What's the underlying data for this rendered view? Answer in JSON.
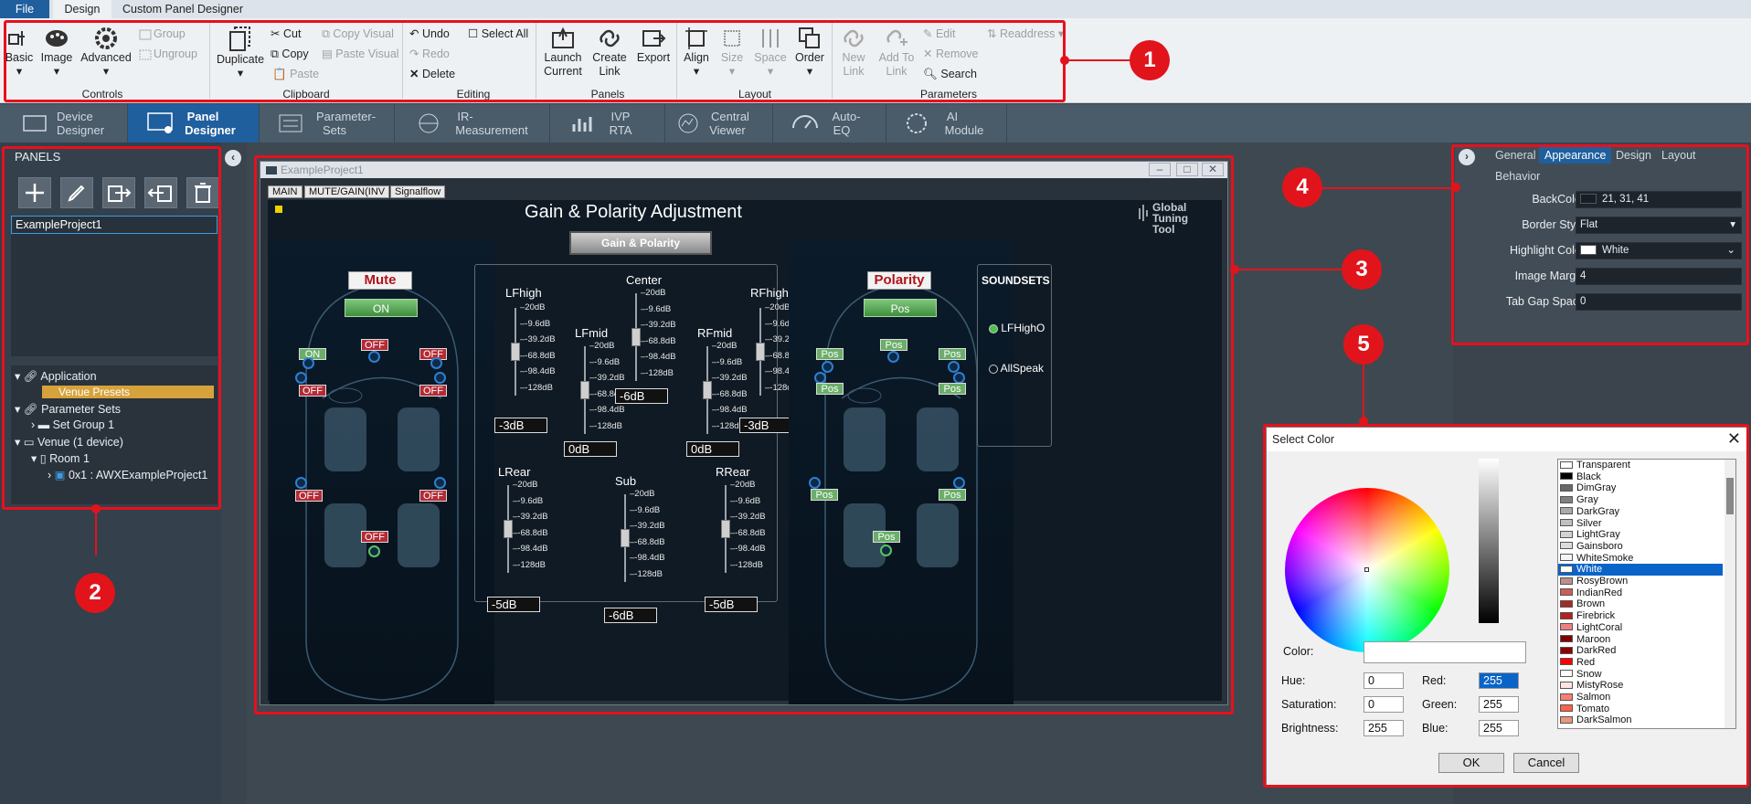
{
  "menu": {
    "tabs": [
      "File",
      "Design",
      "Custom Panel Designer"
    ]
  },
  "ribbon": {
    "groups": {
      "controls": "Controls",
      "clipboard": "Clipboard",
      "editing": "Editing",
      "panels": "Panels",
      "layout": "Layout",
      "parameters": "Parameters"
    },
    "basic": "Basic",
    "image": "Image",
    "advanced": "Advanced",
    "group": "Group",
    "ungroup": "Ungroup",
    "duplicate": "Duplicate",
    "cut": "Cut",
    "copy": "Copy",
    "paste": "Paste",
    "copy_visual": "Copy Visual",
    "paste_visual": "Paste Visual",
    "undo": "Undo",
    "redo": "Redo",
    "delete": "Delete",
    "select_all": "Select All",
    "launch_current": [
      "Launch",
      "Current"
    ],
    "create_link": [
      "Create",
      "Link"
    ],
    "export": "Export",
    "align": "Align",
    "size": "Size",
    "space": "Space",
    "order": "Order",
    "new_link": [
      "New",
      "Link"
    ],
    "add_to_link": [
      "Add To",
      "Link"
    ],
    "edit": "Edit",
    "remove": "Remove",
    "search": "Search",
    "readdress": "Readdress"
  },
  "modules": [
    {
      "l1": "Device",
      "l2": "Designer"
    },
    {
      "l1": "Panel",
      "l2": "Designer"
    },
    {
      "l1": "Parameter-",
      "l2": "Sets"
    },
    {
      "l1": "IR-",
      "l2": "Measurement"
    },
    {
      "l1": "IVP",
      "l2": "RTA"
    },
    {
      "l1": "Central",
      "l2": "Viewer"
    },
    {
      "l1": "Auto-",
      "l2": "EQ"
    },
    {
      "l1": "AI",
      "l2": "Module"
    }
  ],
  "panels": {
    "header": "PANELS",
    "selected": "ExampleProject1"
  },
  "tree": {
    "application": "Application",
    "venue_presets": "Venue Presets",
    "parameter_sets": "Parameter Sets",
    "set_group": "Set Group 1",
    "venue": "Venue (1 device)",
    "room": "Room 1",
    "device": "0x1 : AWXExampleProject1"
  },
  "panel_window": {
    "title": "ExampleProject1",
    "tabs": [
      "MAIN",
      "MUTE/GAIN(INV",
      "Signalflow"
    ],
    "heading": "Gain & Polarity Adjustment",
    "center_button": "Gain & Polarity",
    "brand": [
      "Global",
      "Tuning",
      "Tool"
    ]
  },
  "mute": {
    "title": "Mute",
    "toggle": "ON",
    "chips": [
      "OFF",
      "ON",
      "OFF",
      "OFF",
      "OFF",
      "OFF",
      "OFF",
      "OFF"
    ]
  },
  "polarity": {
    "title": "Polarity",
    "toggle": "Pos",
    "chips": [
      "Pos",
      "Pos",
      "Pos",
      "Pos",
      "Pos",
      "Pos",
      "Pos",
      "Pos"
    ]
  },
  "gain": {
    "ticks": [
      "20dB",
      "-9.6dB",
      "-39.2dB",
      "-68.8dB",
      "-98.4dB",
      "-128dB"
    ],
    "faders": [
      {
        "name": "LFhigh",
        "value": "-3dB"
      },
      {
        "name": "LFmid",
        "value": "0dB"
      },
      {
        "name": "Center",
        "value": "-6dB"
      },
      {
        "name": "RFmid",
        "value": "0dB"
      },
      {
        "name": "RFhigh",
        "value": "-3dB"
      },
      {
        "name": "LRear",
        "value": "-5dB"
      },
      {
        "name": "Sub",
        "value": "-6dB"
      },
      {
        "name": "RRear",
        "value": "-5dB"
      }
    ]
  },
  "soundsets": {
    "title": "SOUNDSETS",
    "items": [
      "LFHighO",
      "AllSpeak"
    ]
  },
  "properties": {
    "tabs": [
      "General",
      "Appearance",
      "Design",
      "Layout",
      "Behavior"
    ],
    "rows": [
      {
        "label": "BackColor",
        "value": "21, 31, 41"
      },
      {
        "label": "Border Style",
        "value": "Flat"
      },
      {
        "label": "Highlight Color",
        "value": "White"
      },
      {
        "label": "Image Margin",
        "value": "4"
      },
      {
        "label": "Tab Gap Space",
        "value": "0"
      }
    ]
  },
  "dialog": {
    "title": "Select Color",
    "color_label": "Color:",
    "hue_label": "Hue:",
    "hue": "0",
    "sat_label": "Saturation:",
    "sat": "0",
    "bri_label": "Brightness:",
    "bri": "255",
    "red_label": "Red:",
    "red": "255",
    "green_label": "Green:",
    "green": "255",
    "blue_label": "Blue:",
    "blue": "255",
    "ok": "OK",
    "cancel": "Cancel",
    "colors": [
      {
        "name": "Transparent",
        "hex": "#ffffff"
      },
      {
        "name": "Black",
        "hex": "#000000"
      },
      {
        "name": "DimGray",
        "hex": "#696969"
      },
      {
        "name": "Gray",
        "hex": "#808080"
      },
      {
        "name": "DarkGray",
        "hex": "#a9a9a9"
      },
      {
        "name": "Silver",
        "hex": "#c0c0c0"
      },
      {
        "name": "LightGray",
        "hex": "#d3d3d3"
      },
      {
        "name": "Gainsboro",
        "hex": "#dcdcdc"
      },
      {
        "name": "WhiteSmoke",
        "hex": "#f5f5f5"
      },
      {
        "name": "White",
        "hex": "#ffffff"
      },
      {
        "name": "RosyBrown",
        "hex": "#bc8f8f"
      },
      {
        "name": "IndianRed",
        "hex": "#cd5c5c"
      },
      {
        "name": "Brown",
        "hex": "#a52a2a"
      },
      {
        "name": "Firebrick",
        "hex": "#b22222"
      },
      {
        "name": "LightCoral",
        "hex": "#f08080"
      },
      {
        "name": "Maroon",
        "hex": "#800000"
      },
      {
        "name": "DarkRed",
        "hex": "#8b0000"
      },
      {
        "name": "Red",
        "hex": "#ff0000"
      },
      {
        "name": "Snow",
        "hex": "#fffafa"
      },
      {
        "name": "MistyRose",
        "hex": "#ffe4e1"
      },
      {
        "name": "Salmon",
        "hex": "#fa8072"
      },
      {
        "name": "Tomato",
        "hex": "#ff6347"
      },
      {
        "name": "DarkSalmon",
        "hex": "#e9967a"
      }
    ]
  },
  "callouts": [
    "1",
    "2",
    "3",
    "4",
    "5"
  ]
}
